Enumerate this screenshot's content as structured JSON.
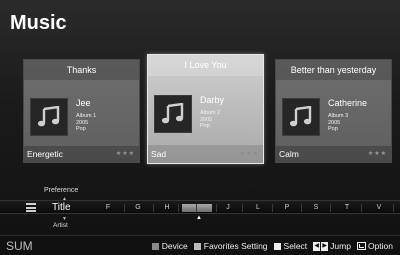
{
  "app": {
    "title": "Music"
  },
  "cards": [
    {
      "title": "Thanks",
      "artist": "Jee",
      "album": "Album 1",
      "year": "2005",
      "genre": "Pop",
      "mood": "Energetic",
      "stars": "★★★",
      "selected": false
    },
    {
      "title": "I Love You",
      "artist": "Darby",
      "album": "Album 2",
      "year": "2005",
      "genre": "Pop",
      "mood": "Sad",
      "stars": "★★★",
      "selected": true
    },
    {
      "title": "Better than yesterday",
      "artist": "Catherine",
      "album": "Album 3",
      "year": "2005",
      "genre": "Pop",
      "mood": "Calm",
      "stars": "★★★",
      "selected": false
    }
  ],
  "sort": {
    "prev": "Preference",
    "current": "Title",
    "next": "Artist",
    "letters": [
      "F",
      "G",
      "H",
      "J",
      "L",
      "P",
      "S",
      "T",
      "V"
    ]
  },
  "bottom": {
    "brand": "SUM",
    "hints": {
      "device": "Device",
      "favorites": "Favorites Setting",
      "select": "Select",
      "jump": "Jump",
      "option": "Option"
    },
    "key_colors": {
      "device": "#8a8a8a",
      "favorites": "#bcbcbc",
      "select": "#eeeeee"
    }
  }
}
